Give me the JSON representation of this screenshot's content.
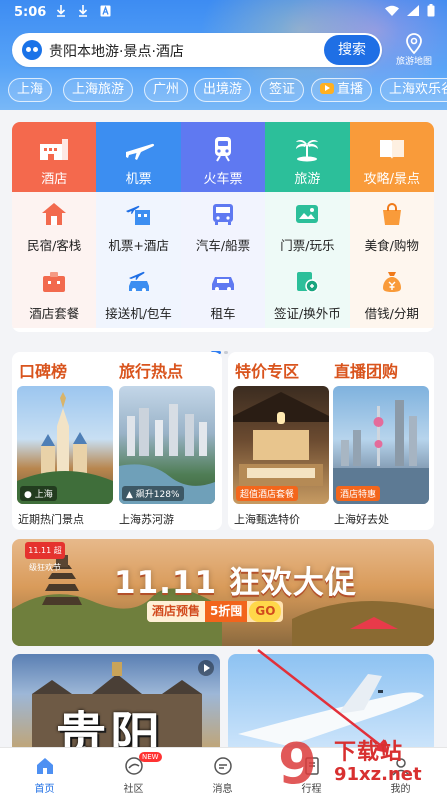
{
  "status_bar": {
    "time": "5:06",
    "left_icons": [
      "download-icon",
      "download-icon",
      "text-a-icon"
    ],
    "right_icons": [
      "wifi-icon",
      "signal-icon",
      "battery-icon"
    ]
  },
  "search": {
    "text": "贵阳本地游·景点·酒店",
    "button_label": "搜索",
    "map_label": "旅游地图"
  },
  "city_tabs": [
    "上海",
    "上海旅游",
    "广州",
    "出境游",
    "签证",
    "直播",
    "上海欢乐谷"
  ],
  "main_grid": {
    "primary": [
      {
        "label": "酒店",
        "icon": "hotel-icon",
        "color": "#f4694d"
      },
      {
        "label": "机票",
        "icon": "airplane-icon",
        "color": "#3c8ef1"
      },
      {
        "label": "火车票",
        "icon": "train-icon",
        "color": "#5f79f1"
      },
      {
        "label": "旅游",
        "icon": "palm-tree-icon",
        "color": "#2cbf9a"
      },
      {
        "label": "攻略/景点",
        "icon": "guidebook-icon",
        "color": "#f99b3a"
      }
    ],
    "secondary_row1": [
      {
        "label": "民宿/客栈",
        "icon": "house-icon"
      },
      {
        "label": "机票+酒店",
        "icon": "plane-hotel-icon"
      },
      {
        "label": "汽车/船票",
        "icon": "bus-icon"
      },
      {
        "label": "门票/玩乐",
        "icon": "ticket-icon"
      },
      {
        "label": "美食/购物",
        "icon": "shopping-bag-icon"
      }
    ],
    "secondary_row2": [
      {
        "label": "酒店套餐",
        "icon": "hotel-package-icon"
      },
      {
        "label": "接送机/包车",
        "icon": "airport-car-icon"
      },
      {
        "label": "租车",
        "icon": "car-icon"
      },
      {
        "label": "签证/换外币",
        "icon": "visa-currency-icon"
      },
      {
        "label": "借钱/分期",
        "icon": "money-bag-icon"
      }
    ]
  },
  "features": {
    "left": {
      "title1": "口碑榜",
      "title2": "旅行热点",
      "tiles": [
        {
          "badge": "上海",
          "caption": "近期热门景点"
        },
        {
          "badge": "飙升128%",
          "caption": "上海苏河游"
        }
      ]
    },
    "right": {
      "title1": "特价专区",
      "title2": "直播团购",
      "tiles": [
        {
          "tag": "超值酒店套餐",
          "caption": "上海甄选特价"
        },
        {
          "tag": "酒店特惠",
          "caption": "上海好去处"
        }
      ]
    }
  },
  "banner": {
    "badge": "11.11 超级狂欢节",
    "title": "11.11 狂欢大促",
    "cta_a": "酒店预售",
    "cta_b": "5折囤",
    "cta_go": "GO"
  },
  "feed": {
    "left_title": "贵阳"
  },
  "bottom_nav": [
    {
      "label": "首页",
      "icon": "home-icon",
      "active": true
    },
    {
      "label": "社区",
      "icon": "community-icon",
      "badge": "NEW"
    },
    {
      "label": "消息",
      "icon": "message-icon"
    },
    {
      "label": "行程",
      "icon": "itinerary-icon"
    },
    {
      "label": "我的",
      "icon": "profile-icon"
    }
  ],
  "watermark": {
    "logo_digit": "9",
    "title": "下载站",
    "url": "91xz.net"
  }
}
